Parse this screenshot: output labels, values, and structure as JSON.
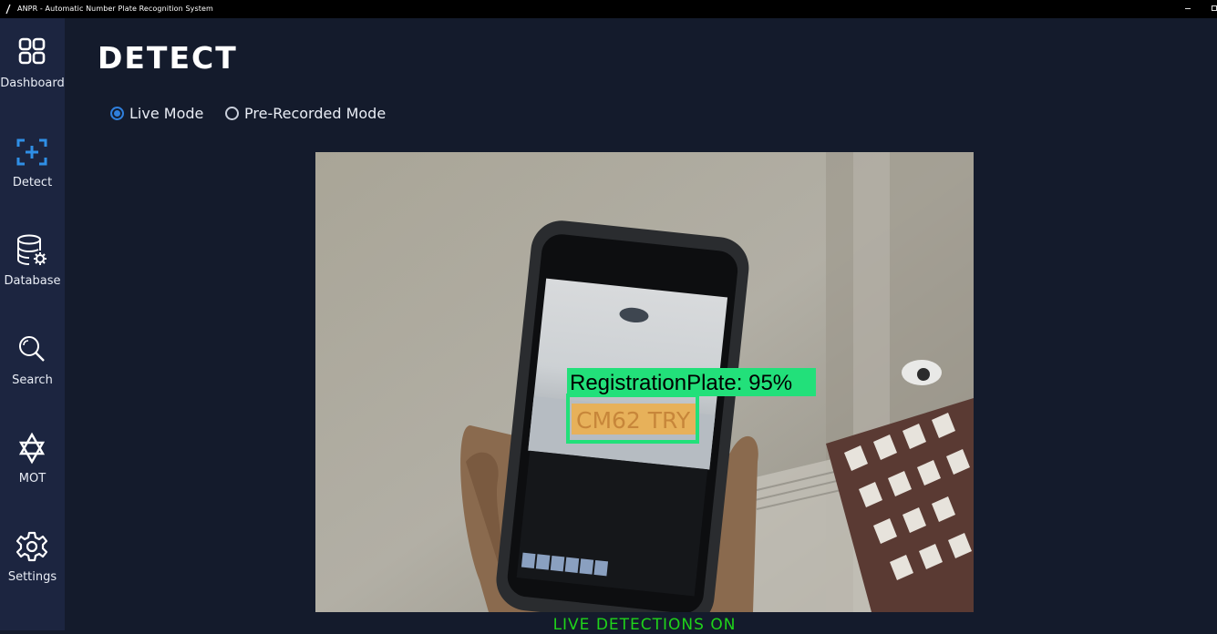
{
  "window": {
    "title": "ANPR - Automatic Number Plate Recognition System"
  },
  "sidebar": {
    "items": [
      {
        "label": "Dashboard",
        "icon": "dashboard-icon"
      },
      {
        "label": "Detect",
        "icon": "detect-icon",
        "active": true
      },
      {
        "label": "Database",
        "icon": "database-icon"
      },
      {
        "label": "Search",
        "icon": "search-icon"
      },
      {
        "label": "MOT",
        "icon": "mot-icon"
      },
      {
        "label": "Settings",
        "icon": "gear-icon"
      }
    ]
  },
  "main": {
    "title": "DETECT",
    "modes": [
      {
        "label": "Live Mode",
        "selected": true
      },
      {
        "label": "Pre-Recorded Mode",
        "selected": false
      }
    ],
    "feed": {
      "detection_label": "RegistrationPlate: 95%",
      "plate_text": "CM62 TRY"
    },
    "status": "LIVE DETECTIONS ON"
  },
  "colors": {
    "accent": "#2f7fdc",
    "detection_box": "#22e07a",
    "status": "#1fd41a",
    "sidebar": "#1c2540",
    "background": "#141b2c"
  }
}
